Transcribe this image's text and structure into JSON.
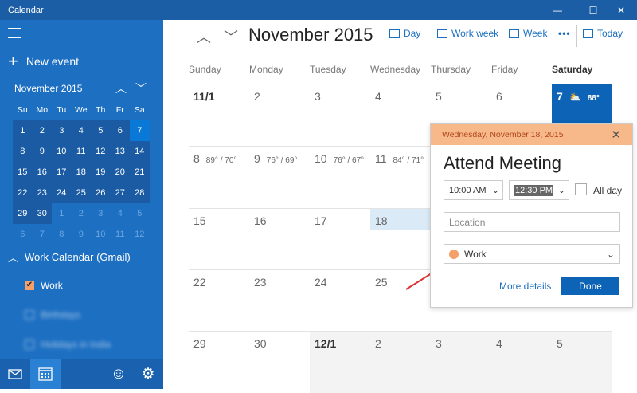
{
  "app": {
    "title": "Calendar"
  },
  "window": {
    "minimize": "—",
    "maximize": "☐",
    "close": "✕"
  },
  "sidebar": {
    "new_event": "New event",
    "mini": {
      "title": "November 2015",
      "weekdays": [
        "Su",
        "Mo",
        "Tu",
        "We",
        "Th",
        "Fr",
        "Sa"
      ],
      "weeks": [
        [
          "1",
          "2",
          "3",
          "4",
          "5",
          "6",
          "7"
        ],
        [
          "8",
          "9",
          "10",
          "11",
          "12",
          "13",
          "14"
        ],
        [
          "15",
          "16",
          "17",
          "18",
          "19",
          "20",
          "21"
        ],
        [
          "22",
          "23",
          "24",
          "25",
          "26",
          "27",
          "28"
        ],
        [
          "29",
          "30",
          "1",
          "2",
          "3",
          "4",
          "5"
        ],
        [
          "6",
          "7",
          "8",
          "9",
          "10",
          "11",
          "12"
        ]
      ]
    },
    "group": "Work Calendar (Gmail)",
    "calendars": [
      {
        "label": "Work",
        "checked": true
      },
      {
        "label": "Birthdays"
      },
      {
        "label": "Holidays in India"
      }
    ]
  },
  "toolbar": {
    "month": "November 2015",
    "day": "Day",
    "work_week": "Work week",
    "week": "Week",
    "more": "•••",
    "today": "Today"
  },
  "grid": {
    "days": [
      "Sunday",
      "Monday",
      "Tuesday",
      "Wednesday",
      "Thursday",
      "Friday",
      "Saturday"
    ],
    "weeks": [
      [
        {
          "d": "11/1"
        },
        {
          "d": "2"
        },
        {
          "d": "3"
        },
        {
          "d": "4"
        },
        {
          "d": "5"
        },
        {
          "d": "6"
        },
        {
          "d": "7",
          "t": "88°"
        }
      ],
      [
        {
          "d": "8",
          "t": "89° / 70°"
        },
        {
          "d": "9",
          "t": "76° / 69°"
        },
        {
          "d": "10",
          "t": "76° / 67°"
        },
        {
          "d": "11",
          "t": "84° / 71°"
        },
        {
          "d": ""
        },
        {
          "d": ""
        },
        {
          "d": ""
        }
      ],
      [
        {
          "d": "15"
        },
        {
          "d": "16"
        },
        {
          "d": "17"
        },
        {
          "d": "18"
        },
        {
          "d": ""
        },
        {
          "d": ""
        },
        {
          "d": ""
        }
      ],
      [
        {
          "d": "22"
        },
        {
          "d": "23"
        },
        {
          "d": "24"
        },
        {
          "d": "25"
        },
        {
          "d": ""
        },
        {
          "d": ""
        },
        {
          "d": ""
        }
      ],
      [
        {
          "d": "29"
        },
        {
          "d": "30"
        },
        {
          "d": "12/1"
        },
        {
          "d": "2"
        },
        {
          "d": "3"
        },
        {
          "d": "4"
        },
        {
          "d": "5"
        }
      ]
    ]
  },
  "popup": {
    "date": "Wednesday, November 18, 2015",
    "title": "Attend Meeting",
    "start": "10:00 AM",
    "end": "12:30 PM",
    "all_day": "All day",
    "location_placeholder": "Location",
    "calendar": "Work",
    "more_details": "More details",
    "done": "Done"
  },
  "colors": {
    "sidebar": "#1d6fc2",
    "accent": "#0d63b5",
    "work": "#f3a06b",
    "popup_header": "#f7b98a"
  }
}
